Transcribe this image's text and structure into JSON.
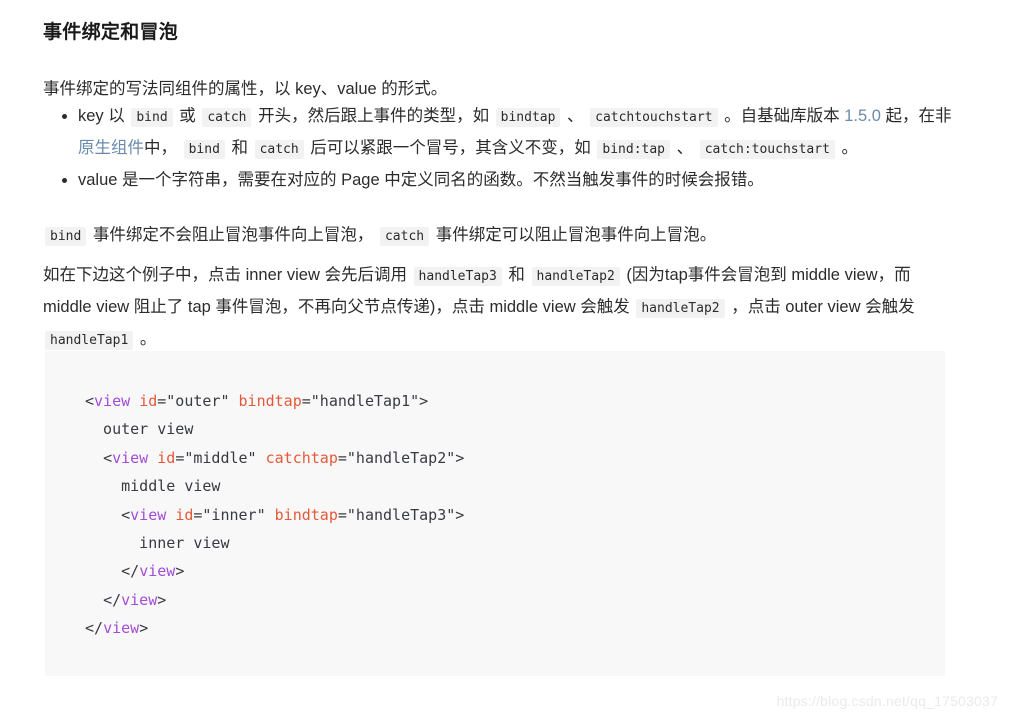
{
  "heading": "事件绑定和冒泡",
  "intro": "事件绑定的写法同组件的属性，以 key、value 的形式。",
  "bullets": [
    {
      "seg1": "key 以 ",
      "code1": "bind",
      "seg2": " 或 ",
      "code2": "catch",
      "seg3": " 开头，然后跟上事件的类型，如 ",
      "code3": "bindtap",
      "seg4": " 、 ",
      "code4": "catchtouchstart",
      "seg5": " 。自基础库版本 ",
      "link1": "1.5.0",
      "seg6": " 起，在非",
      "link2": "原生组件",
      "seg7": "中， ",
      "code5": "bind",
      "seg8": " 和 ",
      "code6": "catch",
      "seg9": " 后可以紧跟一个冒号，其含义不变，如 ",
      "code7": "bind:tap",
      "seg10": " 、 ",
      "code8": "catch:touchstart",
      "seg11": " 。"
    },
    {
      "seg1": "value 是一个字符串，需要在对应的 Page 中定义同名的函数。不然当触发事件的时候会报错。"
    }
  ],
  "note": {
    "code1": "bind",
    "seg1": " 事件绑定不会阻止冒泡事件向上冒泡， ",
    "code2": "catch",
    "seg2": " 事件绑定可以阻止冒泡事件向上冒泡。"
  },
  "description": {
    "seg1": "如在下边这个例子中，点击 inner view 会先后调用 ",
    "code1": "handleTap3",
    "seg2": " 和 ",
    "code2": "handleTap2",
    "seg3": " (因为tap事件会冒泡到 middle view，而 middle view 阻止了 tap 事件冒泡，不再向父节点传递)，点击 middle view 会触发 ",
    "code3": "handleTap2",
    "seg4": " ，点击 outer view 会触发 ",
    "code4": "handleTap1",
    "seg5": " 。"
  },
  "code_block": {
    "language": "wxml",
    "lines": [
      [
        {
          "t": "punc",
          "v": "<"
        },
        {
          "t": "tag",
          "v": "view"
        },
        {
          "t": "text",
          "v": " "
        },
        {
          "t": "attr",
          "v": "id"
        },
        {
          "t": "punc",
          "v": "=\"outer\""
        },
        {
          "t": "text",
          "v": " "
        },
        {
          "t": "attr",
          "v": "bindtap"
        },
        {
          "t": "punc",
          "v": "=\"handleTap1\">"
        }
      ],
      [
        {
          "t": "text",
          "v": "  outer view"
        }
      ],
      [
        {
          "t": "text",
          "v": "  "
        },
        {
          "t": "punc",
          "v": "<"
        },
        {
          "t": "tag",
          "v": "view"
        },
        {
          "t": "text",
          "v": " "
        },
        {
          "t": "attr",
          "v": "id"
        },
        {
          "t": "punc",
          "v": "=\"middle\""
        },
        {
          "t": "text",
          "v": " "
        },
        {
          "t": "attr",
          "v": "catchtap"
        },
        {
          "t": "punc",
          "v": "=\"handleTap2\">"
        }
      ],
      [
        {
          "t": "text",
          "v": "    middle view"
        }
      ],
      [
        {
          "t": "text",
          "v": "    "
        },
        {
          "t": "punc",
          "v": "<"
        },
        {
          "t": "tag",
          "v": "view"
        },
        {
          "t": "text",
          "v": " "
        },
        {
          "t": "attr",
          "v": "id"
        },
        {
          "t": "punc",
          "v": "=\"inner\""
        },
        {
          "t": "text",
          "v": " "
        },
        {
          "t": "attr",
          "v": "bindtap"
        },
        {
          "t": "punc",
          "v": "=\"handleTap3\">"
        }
      ],
      [
        {
          "t": "text",
          "v": "      inner view"
        }
      ],
      [
        {
          "t": "text",
          "v": "    "
        },
        {
          "t": "punc",
          "v": "</"
        },
        {
          "t": "tag",
          "v": "view"
        },
        {
          "t": "punc",
          "v": ">"
        }
      ],
      [
        {
          "t": "text",
          "v": "  "
        },
        {
          "t": "punc",
          "v": "</"
        },
        {
          "t": "tag",
          "v": "view"
        },
        {
          "t": "punc",
          "v": ">"
        }
      ],
      [
        {
          "t": "punc",
          "v": "</"
        },
        {
          "t": "tag",
          "v": "view"
        },
        {
          "t": "punc",
          "v": ">"
        }
      ]
    ]
  },
  "watermark": "https://blog.csdn.net/qq_17503037",
  "colors": {
    "text": "#2b2b2b",
    "link": "#6a8bad",
    "inline_code_bg": "#f2f2f2",
    "code_bg": "#f8f8f8",
    "tag": "#a24cd8",
    "attr": "#e4593a",
    "punct": "#383a42",
    "watermark": "#eaeaea"
  }
}
